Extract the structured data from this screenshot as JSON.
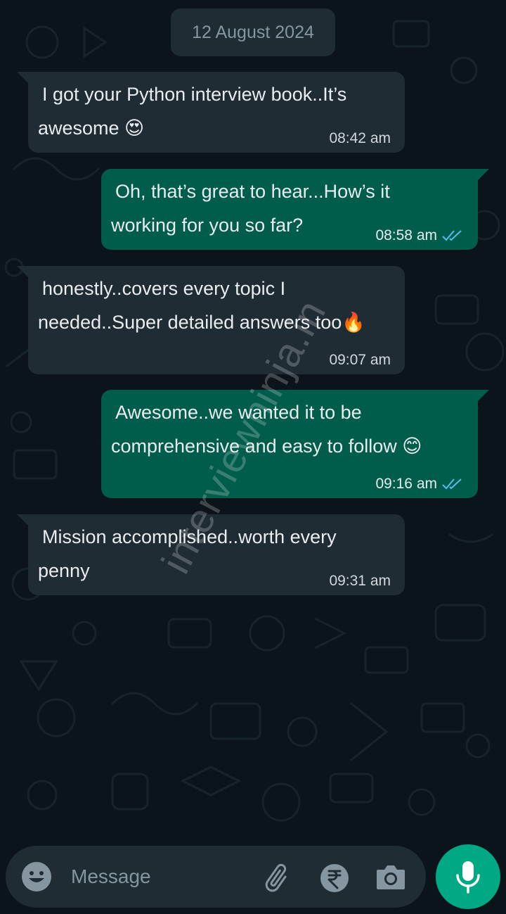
{
  "date_chip": "12 August 2024",
  "messages": [
    {
      "direction": "in",
      "line1": "I got your Python interview book..It’s",
      "line2": "awesome 😍",
      "time": "08:42 am"
    },
    {
      "direction": "out",
      "line1": "Oh, that’s great to hear...How’s it",
      "line2": "working for you so far?",
      "time": "08:58 am",
      "status": "read"
    },
    {
      "direction": "in",
      "line1": "honestly..covers every topic I",
      "line2": "needed..Super detailed answers too🔥",
      "time": "09:07 am"
    },
    {
      "direction": "out",
      "line1": "Awesome..we wanted it to be",
      "line2": "comprehensive and easy to follow 😊",
      "time": "09:16 am",
      "status": "read"
    },
    {
      "direction": "in",
      "line1": "Mission accomplished..worth every",
      "line2": "penny",
      "time": "09:31 am"
    }
  ],
  "watermark": "interviewninja.in",
  "composer": {
    "placeholder": "Message",
    "icons": [
      "emoji-icon",
      "attach-icon",
      "rupee-payment-icon",
      "camera-icon",
      "mic-icon"
    ]
  },
  "colors": {
    "background": "#0b141a",
    "incoming_bubble": "#1f2c34",
    "outgoing_bubble": "#005c4b",
    "read_ticks": "#53bdeb",
    "accent": "#00a884"
  }
}
